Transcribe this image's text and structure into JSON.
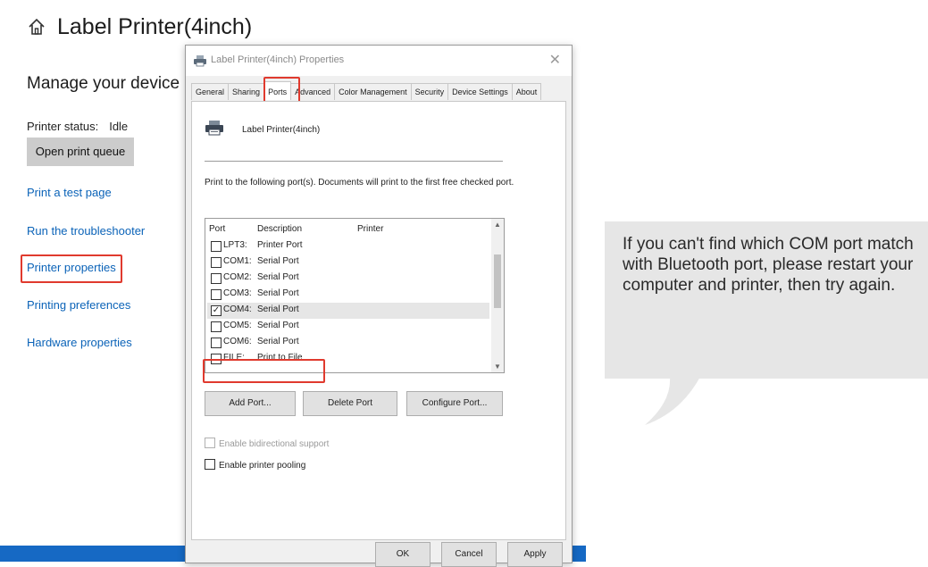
{
  "settings": {
    "home_icon": "home-icon",
    "page_title": "Label Printer(4inch)",
    "manage_heading": "Manage your device",
    "status_label": "Printer status:",
    "status_value": "Idle",
    "open_queue": "Open print queue",
    "links": {
      "test_page": "Print a test page",
      "troubleshooter": "Run the troubleshooter",
      "printer_properties": "Printer properties",
      "printing_preferences": "Printing preferences",
      "hardware_properties": "Hardware properties"
    }
  },
  "dialog": {
    "title": "Label Printer(4inch) Properties",
    "close_glyph": "✕",
    "tabs": [
      "General",
      "Sharing",
      "Ports",
      "Advanced",
      "Color Management",
      "Security",
      "Device Settings",
      "About"
    ],
    "printer_name": "Label Printer(4inch)",
    "port_description": "Print to the following port(s). Documents will print to the first free checked port.",
    "headers": {
      "port": "Port",
      "description": "Description",
      "printer": "Printer"
    },
    "ports": [
      {
        "name": "LPT3:",
        "desc": "Printer Port",
        "checked": false
      },
      {
        "name": "COM1:",
        "desc": "Serial Port",
        "checked": false
      },
      {
        "name": "COM2:",
        "desc": "Serial Port",
        "checked": false
      },
      {
        "name": "COM3:",
        "desc": "Serial Port",
        "checked": false
      },
      {
        "name": "COM4:",
        "desc": "Serial Port",
        "checked": true
      },
      {
        "name": "COM5:",
        "desc": "Serial Port",
        "checked": false
      },
      {
        "name": "COM6:",
        "desc": "Serial Port",
        "checked": false
      },
      {
        "name": "FILE:",
        "desc": "Print to File",
        "checked": false
      }
    ],
    "buttons": {
      "add_port": "Add Port...",
      "delete_port": "Delete Port",
      "configure_port": "Configure Port..."
    },
    "bidi_label": "Enable bidirectional support",
    "pooling_label": "Enable printer pooling",
    "footer": {
      "ok": "OK",
      "cancel": "Cancel",
      "apply": "Apply"
    }
  },
  "callout": {
    "text": "If you can't find which COM port match with Bluetooth port, please restart your computer and printer, then try again."
  },
  "colors": {
    "highlight": "#e03a2e",
    "link": "#0b63b8",
    "taskbar": "#1669c4"
  }
}
